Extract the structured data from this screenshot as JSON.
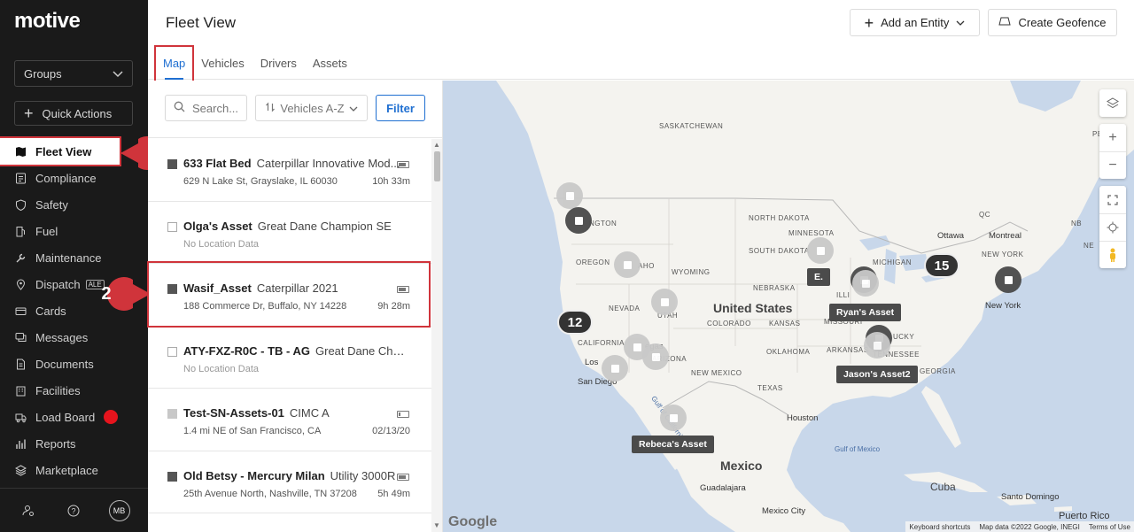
{
  "sidebar": {
    "logo": "motive",
    "groups_label": "Groups",
    "quick_actions_label": "Quick Actions",
    "items": [
      {
        "label": "Fleet View",
        "icon": "map-icon"
      },
      {
        "label": "Compliance",
        "icon": "list-icon"
      },
      {
        "label": "Safety",
        "icon": "shield-icon"
      },
      {
        "label": "Fuel",
        "icon": "fuel-icon"
      },
      {
        "label": "Maintenance",
        "icon": "wrench-icon"
      },
      {
        "label": "Dispatch",
        "icon": "pin-icon",
        "badge": "ALE"
      },
      {
        "label": "Cards",
        "icon": "card-icon"
      },
      {
        "label": "Messages",
        "icon": "chat-icon"
      },
      {
        "label": "Documents",
        "icon": "document-icon"
      },
      {
        "label": "Facilities",
        "icon": "building-icon"
      },
      {
        "label": "Load Board",
        "icon": "truck-icon"
      },
      {
        "label": "Reports",
        "icon": "chart-icon"
      },
      {
        "label": "Marketplace",
        "icon": "layers-icon"
      }
    ],
    "avatar_initials": "MB"
  },
  "callouts": [
    "1",
    "2"
  ],
  "header": {
    "title": "Fleet View",
    "add_entity_label": "Add an Entity",
    "create_geofence_label": "Create Geofence",
    "tabs": [
      "Map",
      "Vehicles",
      "Drivers",
      "Assets"
    ],
    "active_tab": "Map"
  },
  "toolbar": {
    "search_placeholder": "Search...",
    "sort_label": "Vehicles A-Z",
    "filter_label": "Filter"
  },
  "list": [
    {
      "name": "633 Flat Bed",
      "model": "Caterpillar Innovative Mod...",
      "location": "629 N Lake St, Grayslake, IL 60030",
      "time": "10h 33m",
      "checkbox": "dark",
      "battery": "full"
    },
    {
      "name": "Olga's Asset",
      "model": "Great Dane Champion SE",
      "location": "No Location Data",
      "time": "",
      "checkbox": "empty",
      "battery": "none"
    },
    {
      "name": "Wasif_Asset",
      "model": "Caterpillar 2021",
      "location": "188 Commerce Dr, Buffalo, NY 14228",
      "time": "9h 28m",
      "checkbox": "dark",
      "battery": "full"
    },
    {
      "name": "ATY-FXZ-R0C - TB - AG",
      "model": "Great Dane Cham...",
      "location": "No Location Data",
      "time": "",
      "checkbox": "empty",
      "battery": "none"
    },
    {
      "name": "Test-SN-Assets-01",
      "model": "CIMC A",
      "location": "1.4 mi NE of San Francisco, CA",
      "time": "02/13/20",
      "checkbox": "light",
      "battery": "low"
    },
    {
      "name": "Old Betsy - Mercury Milan",
      "model": "Utility 3000R",
      "location": "25th Avenue North, Nashville, TN 37208",
      "time": "5h 49m",
      "checkbox": "dark",
      "battery": "full"
    }
  ],
  "map": {
    "labels": {
      "saskatchewan": "SASKATCHEWAN",
      "washington": "NGTON",
      "oregon": "OREGON",
      "idaho": "AHO",
      "north_dakota": "NORTH DAKOTA",
      "minnesota": "MINNESOTA",
      "south_dakota": "SOUTH DAKOTA",
      "wyoming": "WYOMING",
      "nebraska": "NEBRASKA",
      "nevada": "NEVADA",
      "utah": "UTAH",
      "colorado": "COLORADO",
      "kansas": "KANSAS",
      "missouri": "MISSOURI",
      "california": "CALIFORNIA",
      "arizona": "ARIZONA",
      "new_mexico": "NEW MEXICO",
      "oklahoma": "OKLAHOMA",
      "arkansas": "ARKANSAS",
      "texas": "TEXAS",
      "michigan": "MICHIGAN",
      "illinois": "ILLI",
      "kentucky": "UCKY",
      "tennessee": "TENNESSEE",
      "georgia": "GEORGIA",
      "quebec_qc": "QC",
      "new_york_state": "NEW YORK",
      "nb": "NB",
      "ne": "NE",
      "pe": "PE",
      "us": "United States",
      "mexico": "Mexico",
      "cuba": "Cuba",
      "ottawa": "Ottawa",
      "montreal": "Montreal",
      "new_york": "New York",
      "san_diego": "San Diego",
      "los_angeles": "Los",
      "vegas": "egas",
      "houston": "Houston",
      "guadalajara": "Guadalajara",
      "mexico_city": "Mexico City",
      "santo_domingo": "Santo Domingo",
      "puerto_rico": "Puerto Rico",
      "gulf_mexico": "Gulf of Mexico",
      "gulf_california": "Gulf of California"
    },
    "clusters": [
      "15",
      "12"
    ],
    "asset_tags": [
      "E.",
      "Ryan's Asset",
      "Jason's Asset2",
      "Rebeca's Asset"
    ],
    "attribution": {
      "google": "Google",
      "shortcuts": "Keyboard shortcuts",
      "data": "Map data ©2022 Google, INEGI",
      "terms": "Terms of Use"
    }
  },
  "colors": {
    "sidebar_bg": "#1a1a1a",
    "accent": "#1f6fd1",
    "highlight": "#d0343b",
    "water": "#c8d7ea",
    "land": "#f4f3ef"
  }
}
